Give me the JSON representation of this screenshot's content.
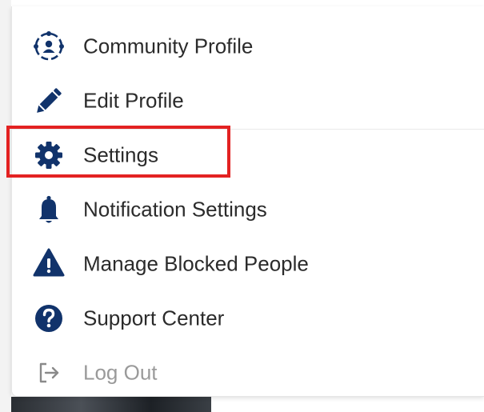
{
  "colors": {
    "icon_primary": "#11336b",
    "icon_muted": "#8a8a8a",
    "text": "#2b2b2b",
    "text_muted": "#9a9a9a",
    "highlight": "#e32222"
  },
  "menu": {
    "items": [
      {
        "label": "Community Profile",
        "icon": "community-profile-icon"
      },
      {
        "label": "Edit Profile",
        "icon": "pencil-icon"
      },
      {
        "label": "Settings",
        "icon": "gear-icon",
        "highlighted": true
      },
      {
        "label": "Notification Settings",
        "icon": "bell-icon"
      },
      {
        "label": "Manage Blocked People",
        "icon": "warning-triangle-icon"
      },
      {
        "label": "Support Center",
        "icon": "question-circle-icon"
      },
      {
        "label": "Log Out",
        "icon": "logout-icon",
        "muted": true
      }
    ]
  }
}
